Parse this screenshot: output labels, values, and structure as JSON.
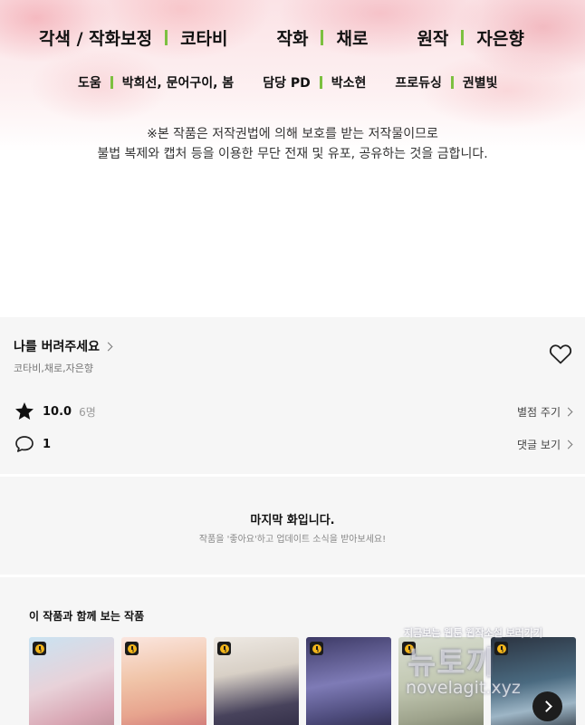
{
  "credits": {
    "row1": [
      "각색 / 작화보정",
      "코타비",
      "작화",
      "채로",
      "원작",
      "자은향"
    ],
    "row2": [
      "도움",
      "박희선, 문어구이, 봄",
      "담당 PD",
      "박소현",
      "프로듀싱",
      "권별빛"
    ],
    "notice_line1": "※본 작품은 저작권법에 의해 보호를 받는 저작물이므로",
    "notice_line2": "불법 복제와 캡처 등을 이용한 무단 전재 및 유포, 공유하는 것을 금합니다."
  },
  "series": {
    "title": "나를 버려주세요",
    "authors": "코타비,채로,자은향"
  },
  "rating": {
    "score": "10.0",
    "count": "6명",
    "action": "별점 주기"
  },
  "comments": {
    "count": "1",
    "action": "댓글 보기"
  },
  "last_episode": {
    "title": "마지막 화입니다.",
    "subtitle": "작품을 '좋아요'하고 업데이트 소식을 받아보세요!"
  },
  "recommendations": {
    "title": "이 작품과 함께 보는 작품",
    "count": 6
  },
  "watermark": {
    "line1": "지금보는 웹툰 웹작소설 보러가기",
    "line2": "뉴토끼",
    "line3": "novelagit.xyz"
  },
  "colors": {
    "accent_bar": "#7cc040",
    "clock_badge": "#f2b51b",
    "panel_bg": "#f6f6f6"
  }
}
